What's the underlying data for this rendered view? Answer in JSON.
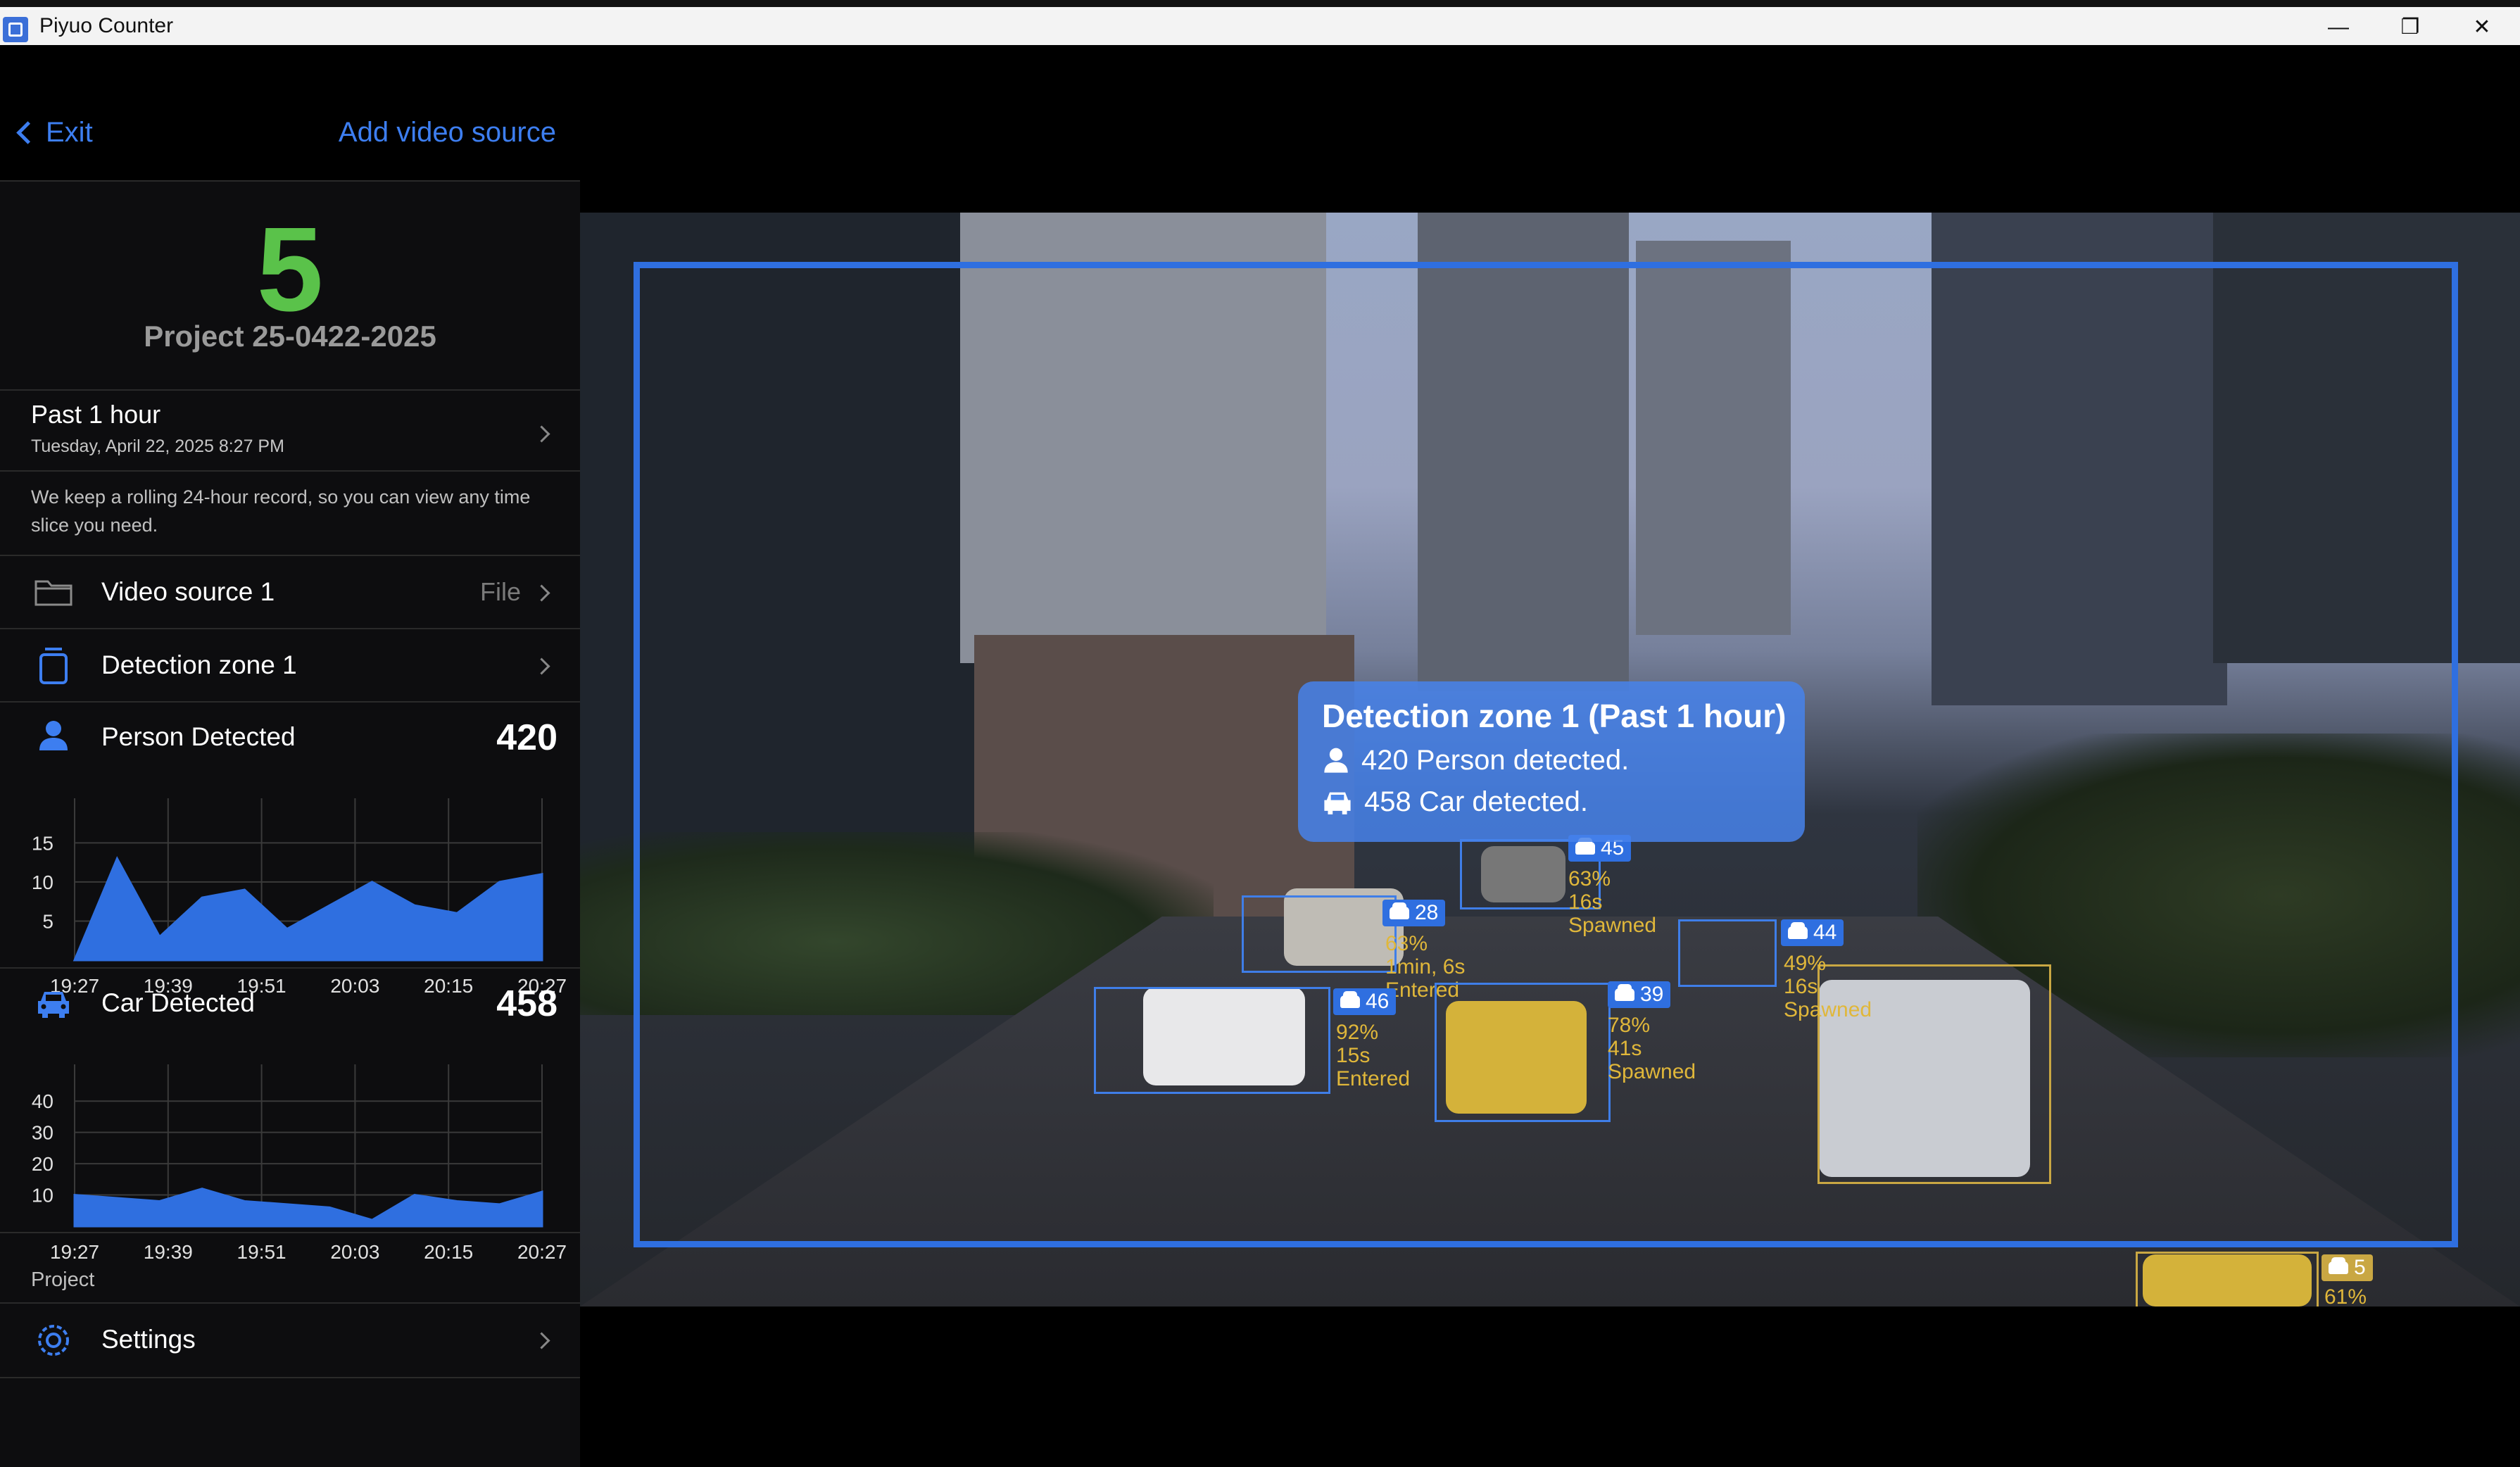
{
  "window": {
    "title": "Piyuo Counter",
    "minimize": "—",
    "restore": "❐",
    "close": "✕"
  },
  "header": {
    "exit_label": "Exit",
    "add_source_label": "Add video source"
  },
  "project": {
    "count": "5",
    "name": "Project 25-0422-2025"
  },
  "time_range": {
    "label": "Past 1 hour",
    "datetime": "Tuesday, April 22, 2025 8:27 PM",
    "note": "We keep a rolling 24-hour record, so you can view any time slice you need."
  },
  "video_source": {
    "label": "Video source 1",
    "type": "File"
  },
  "detection_zone": {
    "label": "Detection zone 1"
  },
  "person": {
    "label": "Person Detected",
    "count": "420"
  },
  "car": {
    "label": "Car Detected",
    "count": "458"
  },
  "footer": {
    "section_label": "Project",
    "settings_label": "Settings"
  },
  "overlay": {
    "title": "Detection zone 1 (Past 1 hour)",
    "person_line": "420 Person detected.",
    "car_line": "458 Car detected."
  },
  "detections": [
    {
      "id": "45",
      "conf": "63%",
      "time": "16s",
      "state": "Spawned"
    },
    {
      "id": "28",
      "conf": "63%",
      "time": "1min, 6s",
      "state": "Entered"
    },
    {
      "id": "46",
      "conf": "92%",
      "time": "15s",
      "state": "Entered"
    },
    {
      "id": "39",
      "conf": "78%",
      "time": "41s",
      "state": "Spawned"
    },
    {
      "id": "44",
      "conf": "49%",
      "time": "16s",
      "state": "Spawned"
    },
    {
      "id": "5",
      "conf": "61%"
    }
  ],
  "colors": {
    "accent": "#3d7ef0",
    "counter_green": "#5ac24a",
    "chart_fill": "#2f6fe0",
    "overlay_text": "#e0b73a"
  },
  "chart_data": [
    {
      "type": "area",
      "title": "",
      "categories": [
        "19:27",
        "19:39",
        "19:51",
        "20:03",
        "20:15",
        "20:27"
      ],
      "x": [
        0,
        1,
        2,
        3,
        4,
        5,
        6,
        7,
        8,
        9,
        10,
        11
      ],
      "series": [
        {
          "values": [
            0,
            13,
            3,
            8,
            9,
            4,
            7,
            10,
            7,
            6,
            10,
            11
          ]
        }
      ],
      "yticks": [
        5,
        10,
        15
      ],
      "ylim": [
        0,
        18
      ],
      "grid": true
    },
    {
      "type": "area",
      "title": "",
      "categories": [
        "19:27",
        "19:39",
        "19:51",
        "20:03",
        "20:15",
        "20:27"
      ],
      "x": [
        0,
        1,
        2,
        3,
        4,
        5,
        6,
        7,
        8,
        9,
        10,
        11
      ],
      "series": [
        {
          "values": [
            10,
            9,
            8,
            12,
            8,
            7,
            6,
            2,
            10,
            8,
            7,
            11
          ]
        }
      ],
      "yticks": [
        10,
        20,
        30,
        40
      ],
      "ylim": [
        0,
        45
      ],
      "grid": true
    }
  ]
}
